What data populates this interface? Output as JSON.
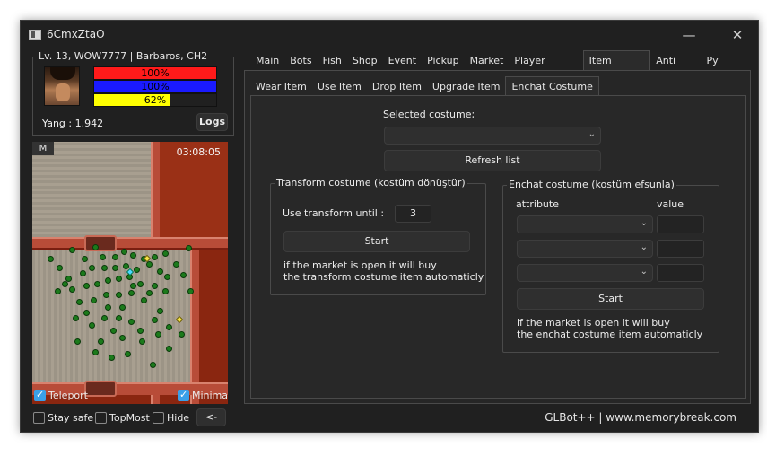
{
  "window": {
    "title": "6CmxZtaO",
    "minimize_glyph": "—",
    "close_glyph": "✕"
  },
  "character": {
    "info": "Lv. 13, WOW7777 | Barbaros, CH2",
    "hp": {
      "label": "100%",
      "value": 1.0,
      "color": "#ff1a1a"
    },
    "sp": {
      "label": "100%",
      "value": 1.0,
      "color": "#1a1aff"
    },
    "exp": {
      "label": "62%",
      "value": 0.62,
      "color": "#ffff00"
    },
    "yang": "Yang : 1.942",
    "logs_label": "Logs"
  },
  "minimap": {
    "mode_label": "M",
    "time": "03:08:05",
    "teleport_label": "Teleport",
    "teleport_checked": true,
    "minimap_label": "Minimap",
    "minimap_checked": true
  },
  "options": {
    "stay_safe": "Stay safe",
    "topmost": "TopMost",
    "hide": "Hide",
    "back_label": "<-"
  },
  "tabs": [
    "Main",
    "Bots",
    "Fish",
    "Shop",
    "Event",
    "Pickup",
    "Market",
    "Player Helper",
    "Item Helper",
    "Anti Ban",
    "Py Loader"
  ],
  "active_tab": "Item Helper",
  "subtabs": [
    "Wear Item",
    "Use Item",
    "Drop Item",
    "Upgrade Item",
    "Enchat Costume"
  ],
  "active_subtab": "Enchat Costume",
  "costume": {
    "selected_label": "Selected costume;",
    "selected_value": "",
    "refresh_label": "Refresh list"
  },
  "transform": {
    "title": "Transform costume (kostüm dönüştür)",
    "until_label": "Use transform until :",
    "until_value": "3",
    "start_label": "Start",
    "note_line1": "if the market is open it will buy",
    "note_line2": "the transform costume item automaticly"
  },
  "enchant": {
    "title": "Enchat costume (kostüm efsunla)",
    "attribute_header": "attribute",
    "value_header": "value",
    "rows": [
      {
        "attribute": "",
        "value": ""
      },
      {
        "attribute": "",
        "value": ""
      },
      {
        "attribute": "",
        "value": ""
      }
    ],
    "start_label": "Start",
    "note_line1": "if the market is open it will buy",
    "note_line2": "the enchat costume item automaticly"
  },
  "footer": "GLBot++ | www.memorybreak.com",
  "icons": {
    "dropdown": "chevron-down-icon",
    "app": "app-window-icon"
  }
}
